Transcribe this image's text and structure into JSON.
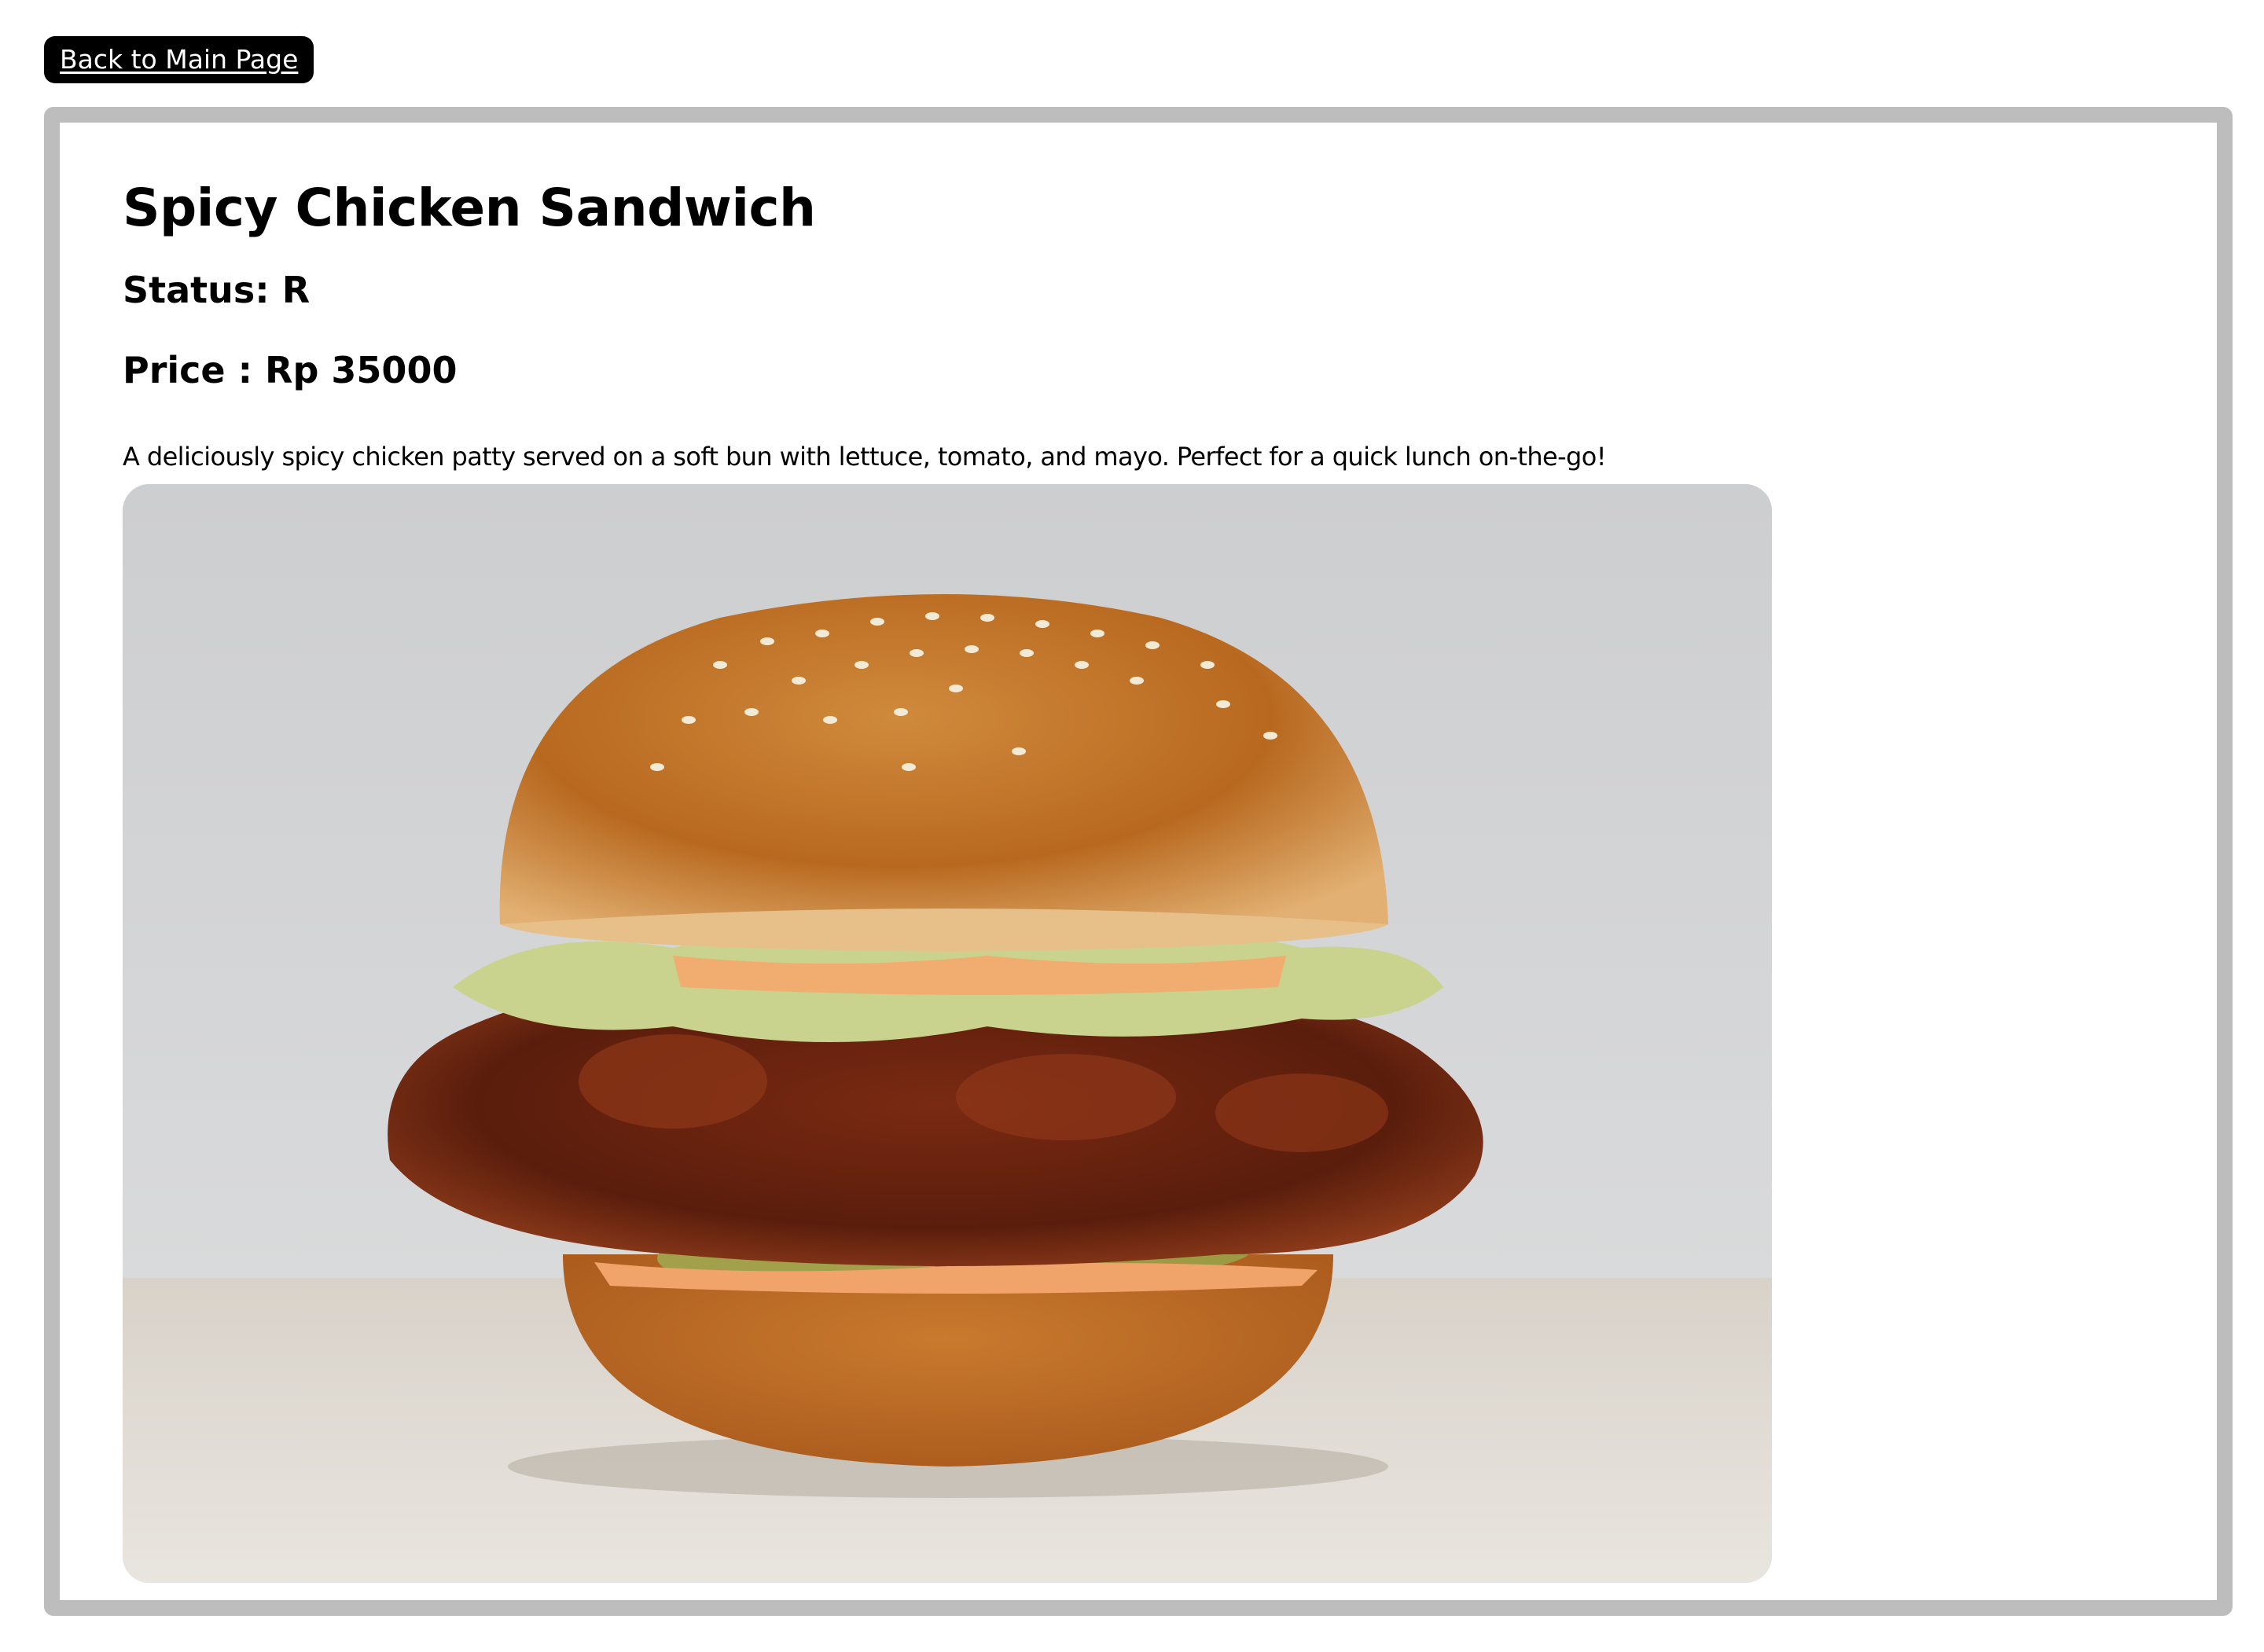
{
  "nav": {
    "back_label": "Back to Main Page"
  },
  "item": {
    "title": "Spicy Chicken Sandwich",
    "status": "Status: R",
    "price": "Price : Rp 35000",
    "description": "A deliciously spicy chicken patty served on a soft bun with lettuce, tomato, and mayo. Perfect for a quick lunch on-the-go!",
    "image_subject": "spicy-chicken-sandwich-photo"
  },
  "colors": {
    "back_button_bg": "#000000",
    "back_button_text": "#ffffff",
    "card_border": "#bdbdbd",
    "page_bg": "#ffffff"
  }
}
